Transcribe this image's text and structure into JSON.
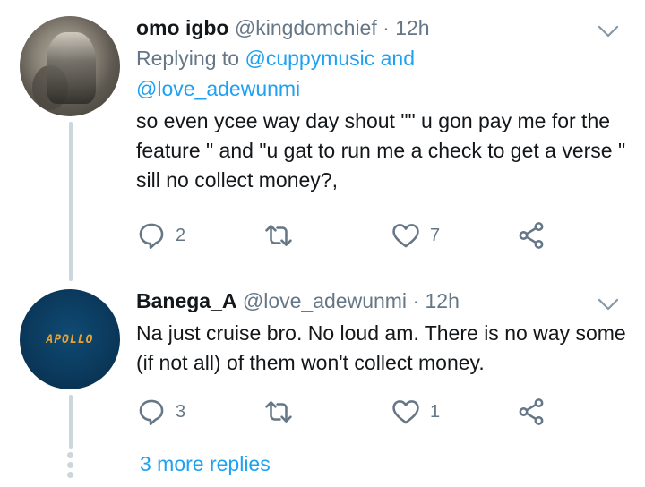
{
  "tweets": [
    {
      "name": "omo igbo",
      "handle": "@kingdomchief",
      "separator": "·",
      "time": "12h",
      "replying_prefix": "Replying to",
      "replying_users": "@cuppymusic and",
      "replying_users_2": "@love_adewunmi",
      "text": "so even ycee way day shout \"\" u gon pay me for the feature \" and \"u gat to run me a check to get a verse \" sill no collect money?,",
      "reply_count": "2",
      "retweet_count": "",
      "like_count": "7"
    },
    {
      "name": "Banega_A",
      "handle": "@love_adewunmi",
      "separator": "·",
      "time": "12h",
      "avatar_text": "APOLLO",
      "text": "Na just cruise bro. No loud am. There is no way some (if not all) of them won't collect money.",
      "reply_count": "3",
      "retweet_count": "",
      "like_count": "1"
    }
  ],
  "more_replies": "3 more replies",
  "icons": [
    "reply-icon",
    "retweet-icon",
    "like-icon",
    "share-icon",
    "chevron-down-icon"
  ],
  "colors": {
    "accent": "#1da1f2",
    "muted": "#657786",
    "thread": "#ccd6dd"
  }
}
